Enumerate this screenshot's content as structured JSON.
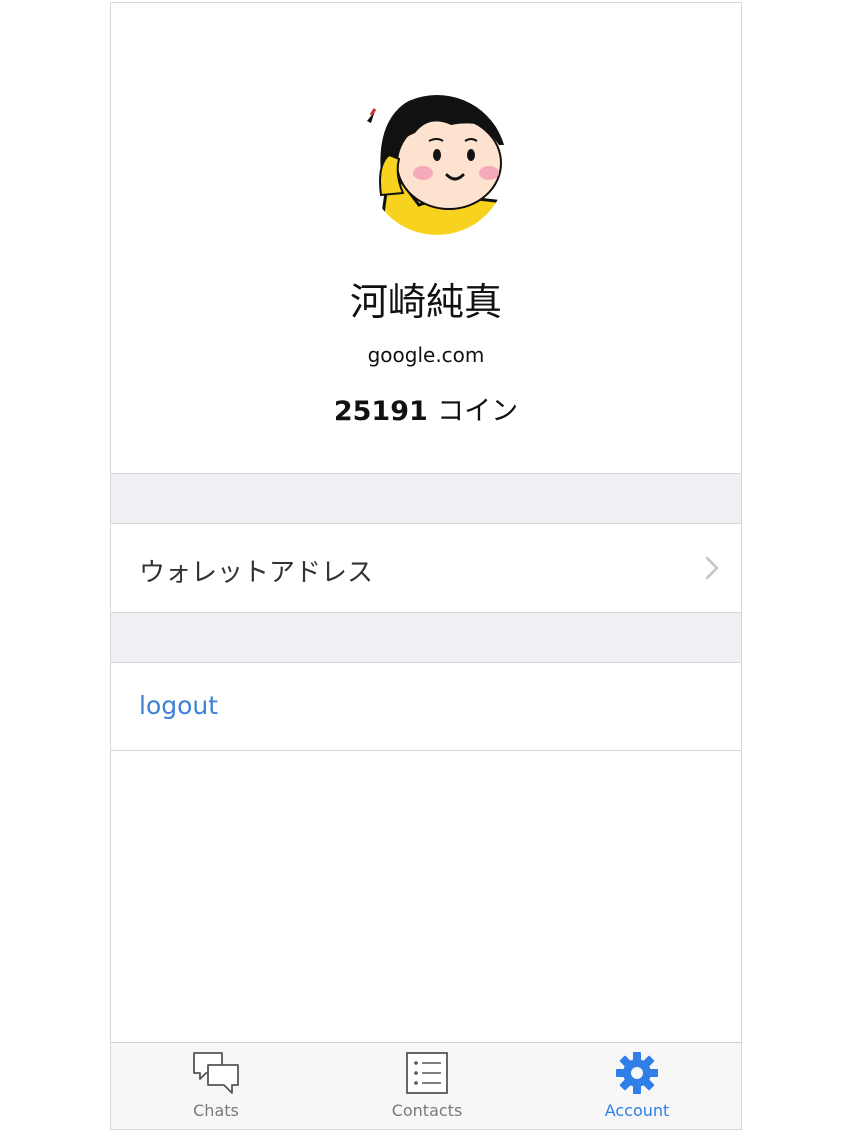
{
  "profile": {
    "name": "河崎純真",
    "domain": "google.com",
    "coins_value": "25191",
    "coins_unit": "コイン"
  },
  "menu": {
    "wallet_label": "ウォレットアドレス",
    "logout_label": "logout"
  },
  "tabbar": {
    "tabs": [
      {
        "label": "Chats",
        "icon": "chat-bubbles-icon",
        "active": false
      },
      {
        "label": "Contacts",
        "icon": "contacts-list-icon",
        "active": false
      },
      {
        "label": "Account",
        "icon": "gear-icon",
        "active": true
      }
    ]
  },
  "colors": {
    "accent": "#2f7fe6",
    "link": "#3b82d6",
    "separator_bg": "#f0eff4",
    "avatar_shirt": "#f7d21e"
  }
}
